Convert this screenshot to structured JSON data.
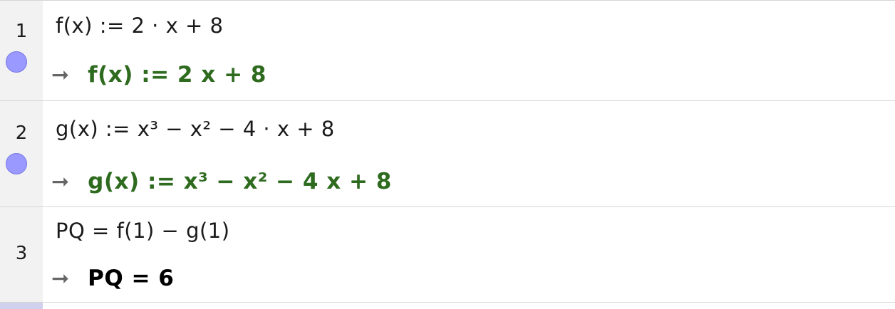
{
  "rows": [
    {
      "number": "1",
      "input": "f(x) :=  2 · x + 8",
      "output": "f(x)  :=  2 x + 8",
      "output_color": "#2e6b1f",
      "visible_toggle": true
    },
    {
      "number": "2",
      "input": "g(x) :=  x³ − x² − 4 · x + 8",
      "output": "g(x)  :=  x³ − x² − 4 x + 8",
      "output_color": "#2e6b1f",
      "visible_toggle": true
    },
    {
      "number": "3",
      "input": "PQ  =  f(1) − g(1)",
      "output": "PQ = 6",
      "output_color": "#000000",
      "visible_toggle": false
    }
  ],
  "output_arrow": "➞",
  "colors": {
    "gutter": "#f2f2f2",
    "marble": "#9999ff",
    "result_green": "#2e6b1f",
    "arrow": "#666666"
  }
}
